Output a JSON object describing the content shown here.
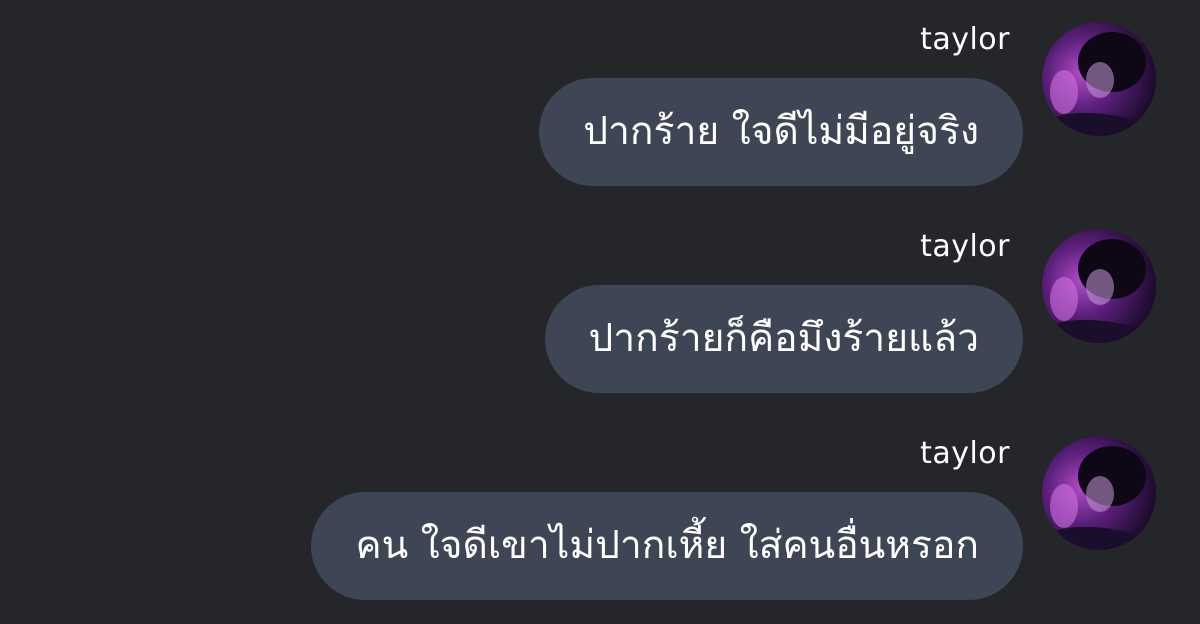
{
  "messages": [
    {
      "sender": "taylor",
      "text": "ปากร้าย ใจดีไม่มีอยู่จริง"
    },
    {
      "sender": "taylor",
      "text": "ปากร้ายก็คือมึงร้ายแล้ว"
    },
    {
      "sender": "taylor",
      "text": "คน ใจดีเขาไม่ปากเหี้ย ใส่คนอื่นหรอก"
    }
  ]
}
